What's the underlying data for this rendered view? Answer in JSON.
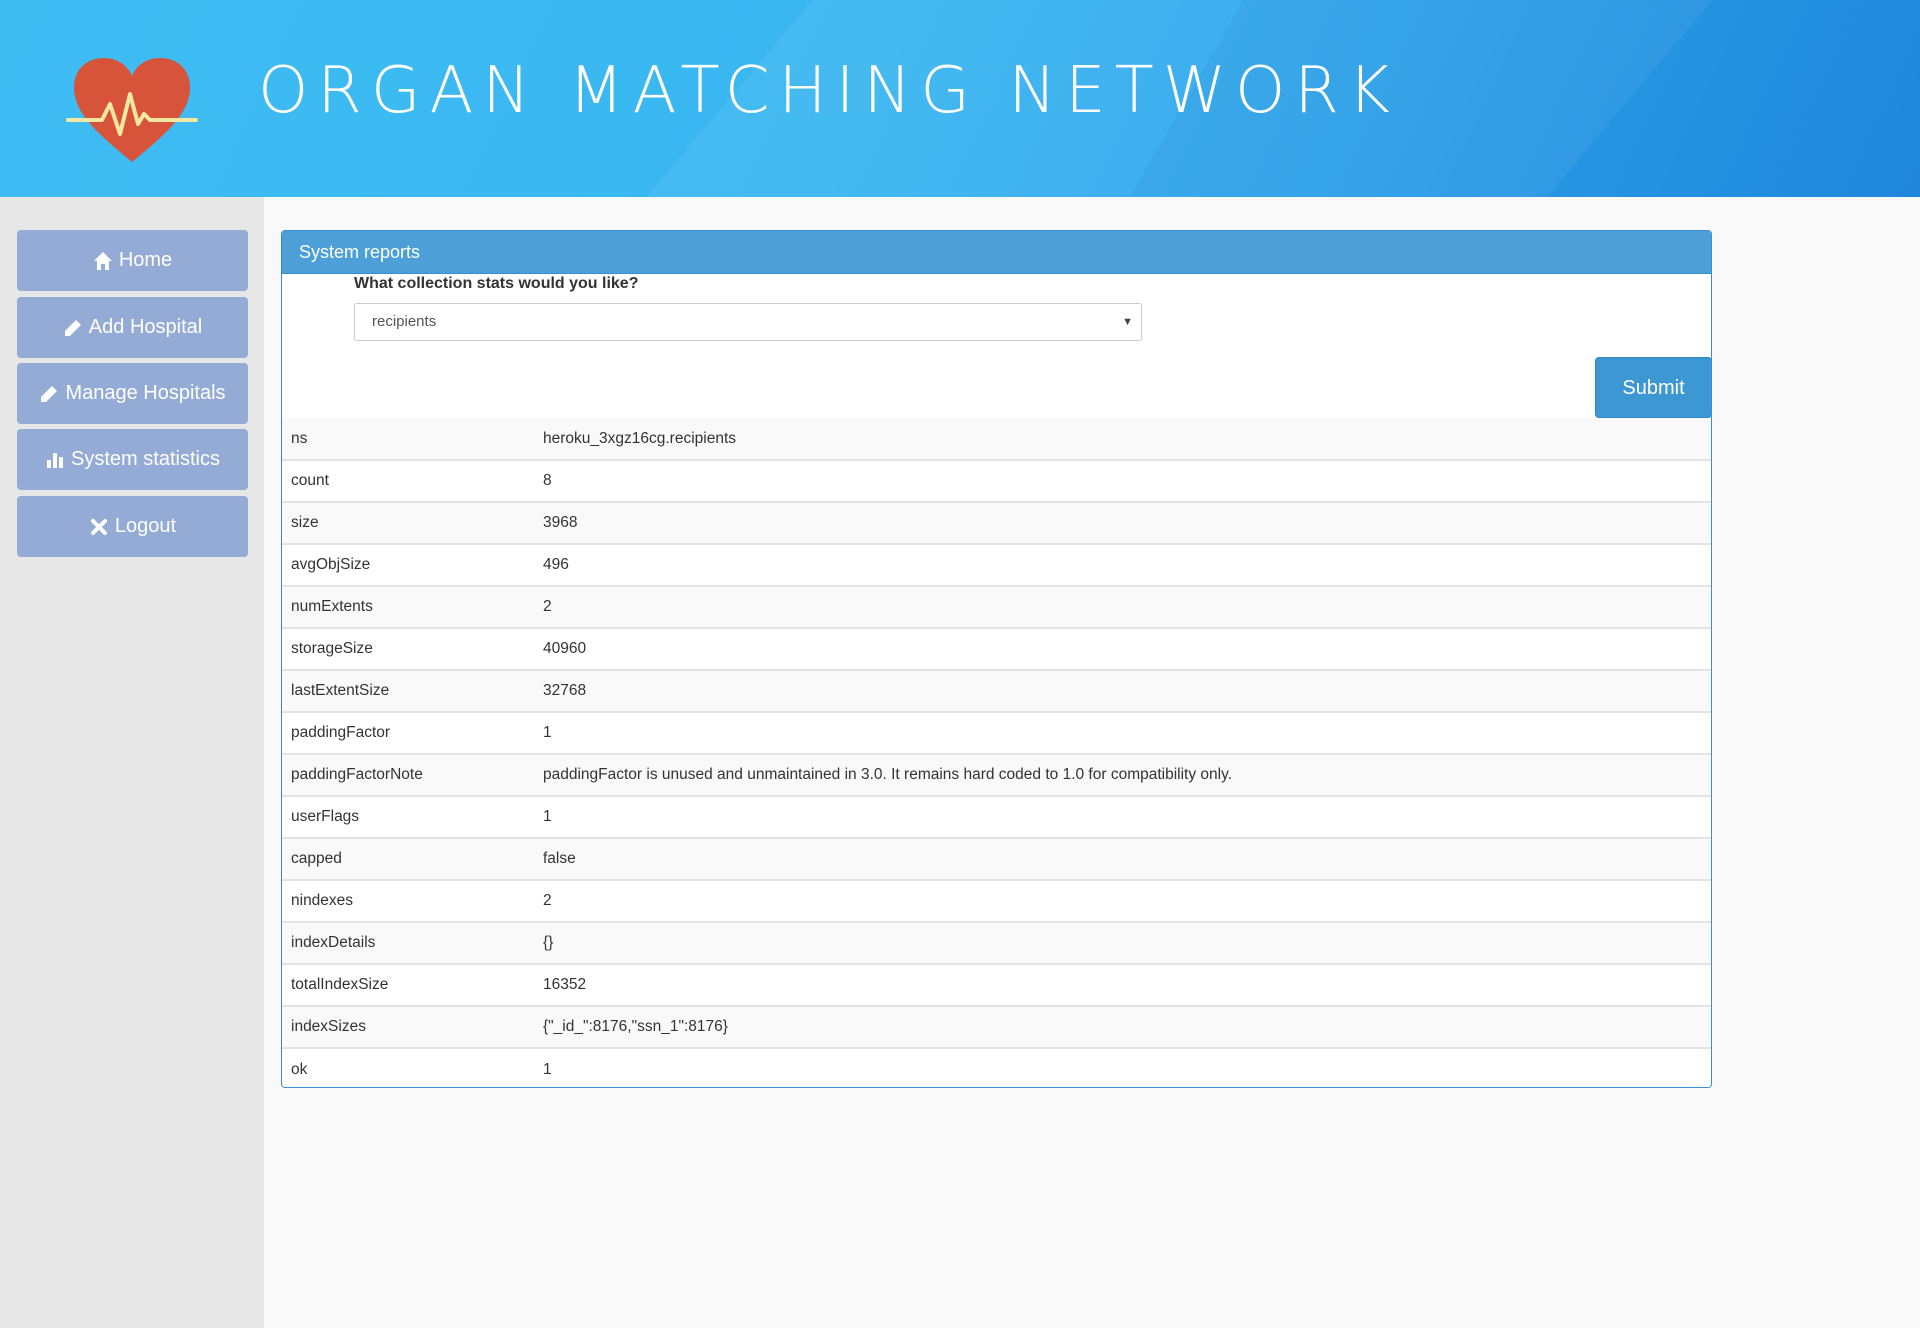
{
  "header": {
    "title": "ORGAN MATCHING NETWORK",
    "logo_icon": "heart-pulse-icon",
    "colors": {
      "heart": "#d7533a",
      "pulse": "#f8e7a3"
    }
  },
  "sidebar": {
    "items": [
      {
        "label": "Home",
        "icon": "home-icon"
      },
      {
        "label": "Add Hospital",
        "icon": "pencil-icon"
      },
      {
        "label": "Manage Hospitals",
        "icon": "pencil-icon"
      },
      {
        "label": "System statistics",
        "icon": "bar-chart-icon"
      },
      {
        "label": "Logout",
        "icon": "close-icon"
      }
    ],
    "button_color": "#94abd6"
  },
  "panel": {
    "title": "System reports",
    "question": "What collection stats would you like?",
    "select_value": "recipients",
    "submit_label": "Submit",
    "accent": "#4d9fd8"
  },
  "stats": [
    {
      "key": "ns",
      "value": "heroku_3xgz16cg.recipients"
    },
    {
      "key": "count",
      "value": "8"
    },
    {
      "key": "size",
      "value": "3968"
    },
    {
      "key": "avgObjSize",
      "value": "496"
    },
    {
      "key": "numExtents",
      "value": "2"
    },
    {
      "key": "storageSize",
      "value": "40960"
    },
    {
      "key": "lastExtentSize",
      "value": "32768"
    },
    {
      "key": "paddingFactor",
      "value": "1"
    },
    {
      "key": "paddingFactorNote",
      "value": "paddingFactor is unused and unmaintained in 3.0. It remains hard coded to 1.0 for compatibility only."
    },
    {
      "key": "userFlags",
      "value": "1"
    },
    {
      "key": "capped",
      "value": "false"
    },
    {
      "key": "nindexes",
      "value": "2"
    },
    {
      "key": "indexDetails",
      "value": "{}"
    },
    {
      "key": "totalIndexSize",
      "value": "16352"
    },
    {
      "key": "indexSizes",
      "value": "{\"_id_\":8176,\"ssn_1\":8176}"
    },
    {
      "key": "ok",
      "value": "1"
    }
  ]
}
